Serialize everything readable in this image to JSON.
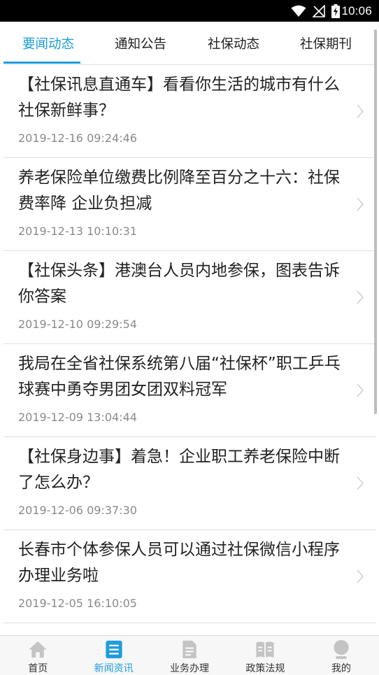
{
  "status_bar": {
    "time": "10:06",
    "icons": [
      "wifi-icon",
      "no-signal-icon",
      "battery-charging-icon"
    ]
  },
  "tabs": [
    {
      "label": "要闻动态",
      "active": true
    },
    {
      "label": "通知公告",
      "active": false
    },
    {
      "label": "社保动态",
      "active": false
    },
    {
      "label": "社保期刊",
      "active": false
    }
  ],
  "news_items": [
    {
      "title": "【社保讯息直通车】看看你生活的城市有什么社保新鲜事？",
      "date": "2019-12-16 09:24:46"
    },
    {
      "title": "养老保险单位缴费比例降至百分之十六：社保费率降 企业负担减",
      "date": "2019-12-13 10:10:31"
    },
    {
      "title": "【社保头条】港澳台人员内地参保，图表告诉你答案",
      "date": "2019-12-10 09:29:54"
    },
    {
      "title": "我局在全省社保系统第八届“社保杯”职工乒乓球赛中勇夺男团女团双料冠军",
      "date": "2019-12-09 13:04:44"
    },
    {
      "title": "【社保身边事】着急！企业职工养老保险中断了怎么办？",
      "date": "2019-12-06 09:37:30"
    },
    {
      "title": "长春市个体参保人员可以通过社保微信小程序办理业务啦",
      "date": "2019-12-05 16:10:05"
    }
  ],
  "bottom_nav": [
    {
      "label": "首页",
      "icon": "home-icon",
      "active": false
    },
    {
      "label": "新闻资讯",
      "icon": "news-icon",
      "active": true
    },
    {
      "label": "业务办理",
      "icon": "document-icon",
      "active": false
    },
    {
      "label": "政策法规",
      "icon": "book-icon",
      "active": false
    },
    {
      "label": "我的",
      "icon": "user-icon",
      "active": false
    }
  ],
  "colors": {
    "accent": "#1e9cdc",
    "inactive_icon": "#c4c4c4"
  }
}
